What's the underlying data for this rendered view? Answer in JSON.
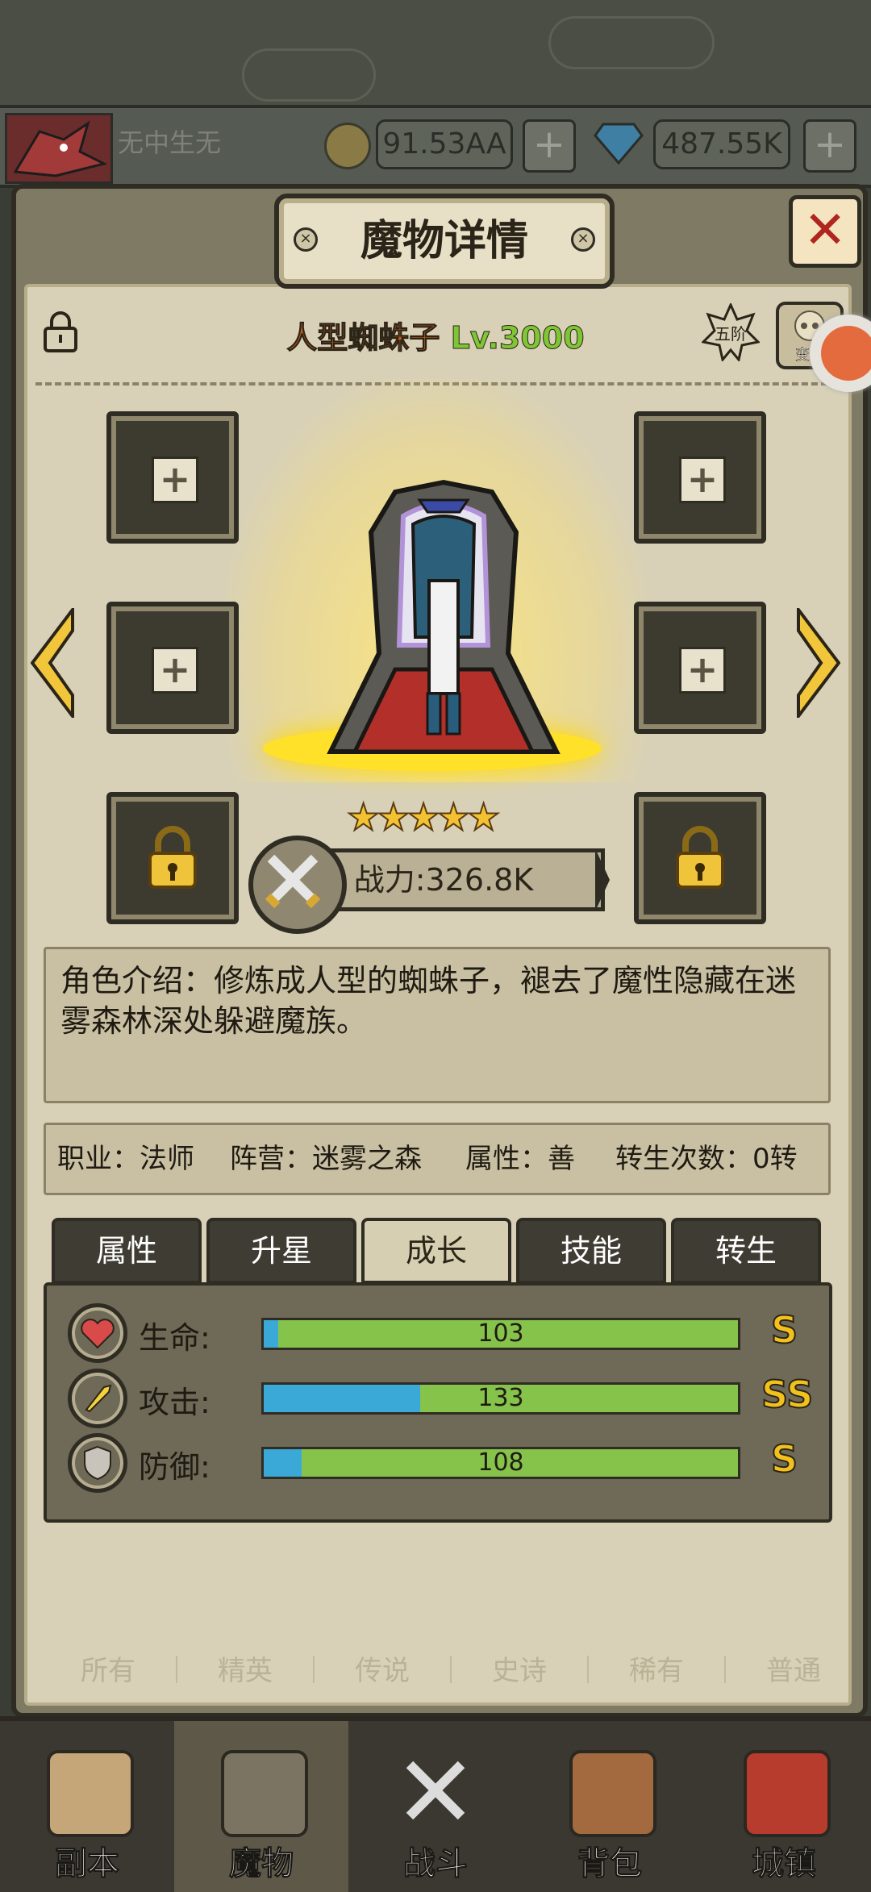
{
  "header": {
    "player_name": "无中生无",
    "gold": "91.53AA",
    "diamonds": "487.55K",
    "add": "+"
  },
  "panel": {
    "title": "魔物详情",
    "close": "✕"
  },
  "monster": {
    "name": "人型蜘蛛子",
    "level": "Lv.3000",
    "rank": "五阶",
    "mutate": "变异",
    "stars": "★★★★★",
    "star_count": 5,
    "power": "战力:326.8K"
  },
  "slots": {
    "add": "+"
  },
  "description": "角色介绍：修炼成人型的蜘蛛子，褪去了魔性隐藏在迷雾森林深处躲避魔族。",
  "info": {
    "job": "职业：法师",
    "camp": "阵营：迷雾之森",
    "attr": "属性：善",
    "rebirth": "转生次数：0转"
  },
  "tabs": [
    "属性",
    "升星",
    "成长",
    "技能",
    "转生"
  ],
  "active_tab": "成长",
  "growth": [
    {
      "label": "生命:",
      "value": "103",
      "fill": 0.03,
      "grade": "S",
      "icon": "heart-icon"
    },
    {
      "label": "攻击:",
      "value": "133",
      "fill": 0.33,
      "grade": "SS",
      "icon": "sword-icon"
    },
    {
      "label": "防御:",
      "value": "108",
      "fill": 0.08,
      "grade": "S",
      "icon": "shield-icon"
    }
  ],
  "nav": [
    {
      "label": "副本",
      "icon": "map-icon"
    },
    {
      "label": "魔物",
      "icon": "monster-icon"
    },
    {
      "label": "战斗",
      "icon": "crossed-swords-icon"
    },
    {
      "label": "背包",
      "icon": "backpack-icon"
    },
    {
      "label": "城镇",
      "icon": "town-icon"
    }
  ],
  "colors": {
    "bar_green": "#86c34b",
    "bar_blue": "#3aa9d8",
    "grade_gold": "#f3c11c",
    "name_orange": "#c15a17",
    "level_green": "#7fc634"
  }
}
